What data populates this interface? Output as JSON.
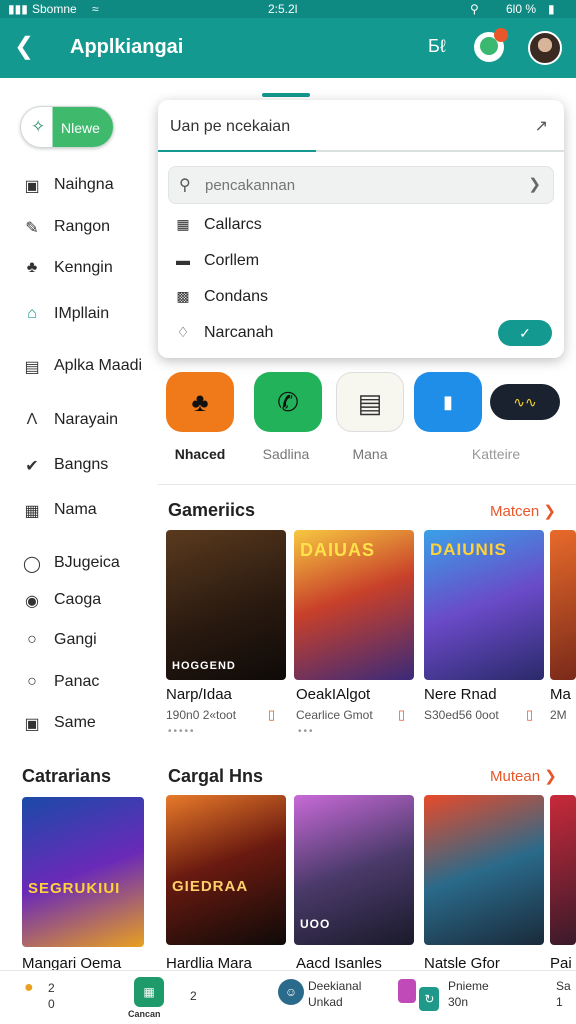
{
  "status_bar": {
    "left": "Sbomne",
    "time": "2:5.2l",
    "battery": "6l0 %"
  },
  "app_bar": {
    "title": "Applkiangai"
  },
  "new_button": {
    "label": "Nlewe"
  },
  "sidebar": {
    "items": [
      {
        "label": "Naihgna",
        "icon": "grid-icon"
      },
      {
        "label": "Rangon",
        "icon": "pen-icon"
      },
      {
        "label": "Kenngin",
        "icon": "figure-icon"
      },
      {
        "label": "IMpllain",
        "icon": "home-icon"
      },
      {
        "label": "Aplka Maadi",
        "icon": "list-icon"
      },
      {
        "label": "Narayain",
        "icon": "triangle-icon"
      },
      {
        "label": "Bangns",
        "icon": "check-circle-icon"
      },
      {
        "label": "Nama",
        "icon": "calendar-icon"
      },
      {
        "label": "BJugeica",
        "icon": "person-icon"
      },
      {
        "label": "Caoga",
        "icon": "circle-icon"
      },
      {
        "label": "Gangi",
        "icon": "circle-icon"
      },
      {
        "label": "Panac",
        "icon": "circle-icon"
      },
      {
        "label": "Same",
        "icon": "shield-icon"
      }
    ],
    "section": "Catrarians"
  },
  "dropdown": {
    "field_text": "Uan pe ncekaian",
    "search_placeholder": "pencakannan",
    "items": [
      {
        "label": "Callarcs",
        "icon": "window-icon"
      },
      {
        "label": "Corllem",
        "icon": "bar-icon"
      },
      {
        "label": "Condans",
        "icon": "square-icon"
      },
      {
        "label": "Narcanah",
        "icon": "tag-icon"
      }
    ]
  },
  "apps": [
    {
      "name": "Nhaced",
      "color": "#f07a1a"
    },
    {
      "name": "Sadlina",
      "color": "#22b35a"
    },
    {
      "name": "Mana",
      "color": "#f5f5f0"
    },
    {
      "name": "",
      "color": "#1e8ee8"
    },
    {
      "name": "Katteire",
      "color": "#1a2230"
    }
  ],
  "sections": {
    "games": {
      "title": "Gameriics",
      "more": "Matcen",
      "cards": [
        {
          "name": "Narp/Idaa",
          "sub": "190n0 2«toot",
          "cover_text": "HOGGEND"
        },
        {
          "name": "OeakIAlgot",
          "sub": "Cearlice Gmot",
          "cover_text": "DAIUAS"
        },
        {
          "name": "Nere Rnad",
          "sub": "S30ed56 0oot",
          "cover_text": "DAIUNIS"
        },
        {
          "name": "Ma",
          "sub": "2M",
          "cover_text": ""
        }
      ]
    },
    "special": {
      "title": "Cargal Hns",
      "more": "Mutean",
      "cards": [
        {
          "name": "Mangari Oema",
          "cover_text": "SEGRUKIUI"
        },
        {
          "name": "Hardlia Mara",
          "cover_text": "GIEDRAA"
        },
        {
          "name": "Aacd Isanles",
          "cover_text": "UOO"
        },
        {
          "name": "Natsle Gfor",
          "cover_text": ""
        },
        {
          "name": "Pai",
          "cover_text": ""
        }
      ]
    }
  },
  "bottom_nav": {
    "items": [
      {
        "label": "2",
        "sub": "0"
      },
      {
        "label": "Cancan",
        "sub": "2"
      },
      {
        "label": "Deekianal",
        "sub": "Unkad"
      },
      {
        "label": "Pnieme",
        "sub": "30n"
      },
      {
        "label": "Sa",
        "sub": "1"
      }
    ]
  }
}
